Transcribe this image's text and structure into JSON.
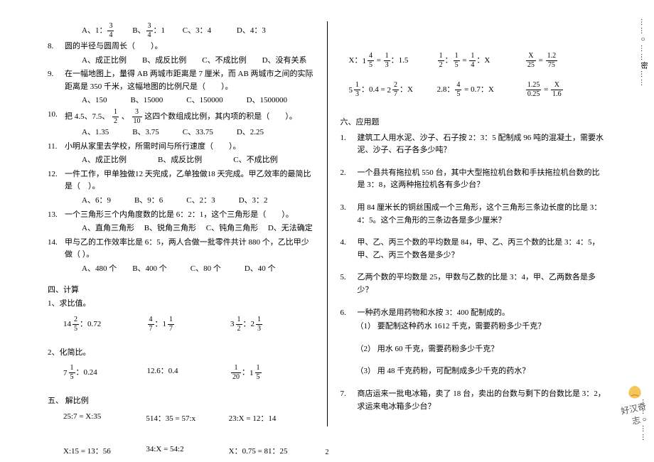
{
  "page_number": "2",
  "edge_top": "……○……密……",
  "edge_bottom_dots": "……○……",
  "edge_bottom_label": "好汉奇志",
  "left": {
    "q7_opts": [
      {
        "pre": "A、1：",
        "num": "3",
        "den": "4"
      },
      {
        "pre": "B、",
        "num": "3",
        "den": "4",
        "post": "：1"
      },
      {
        "pre": "C、3：4",
        "num": "",
        "den": ""
      },
      {
        "pre": "D、4：3",
        "num": "",
        "den": ""
      }
    ],
    "q8": {
      "n": "8.",
      "t": "圆的半径与圆周长（　　）。"
    },
    "q8_opts": "A、成正比例　　B、成反比例　　C、不成比例　　D、没有关系",
    "q9": {
      "n": "9.",
      "t": "在一幅地图上，量得 AB 两城市距离是 7 厘米，而 AB 两城市之间的实际距离是 350 千米，这幅地图的比例尺是（　　）。"
    },
    "q9_opts": "A、150　　　B、15000　　　C、150000　　　D、1500000",
    "q10": {
      "n": "10.",
      "t": ""
    },
    "q10_text_a": "把 4.5、7.5、",
    "q10_text_b": "、",
    "q10_text_c": " 这四个数组成比例，其内项的积是（　　）。",
    "q10_f1": {
      "num": "1",
      "den": "2"
    },
    "q10_f2": {
      "num": "3",
      "den": "10"
    },
    "q10_opts": "A、1.35　　　B、3.75　　　C、33.75　　　D、2.25",
    "q11": {
      "n": "11.",
      "t": "小明从家里去学校，所需时间与所行速度（　　）。"
    },
    "q11_opts": "A、成正比例　　　　B、成反比例　　　　C、不成比例",
    "q12": {
      "n": "12.",
      "t": "一件工作，甲单独做12 天完成，乙单独做18 天完成。甲乙效率的最简比是（　）。"
    },
    "q12_opts": "A、6：9　　　B、9：6　　　C、2：3　　　D、3：2",
    "q13": {
      "n": "13.",
      "t": "一个三角形三个内角度数的比是 6：2：1，这个三角形是（　　）。"
    },
    "q13_opts": "A、直角三角形　 B、锐角三角形　 C、钝角三角形　 D、无法确定",
    "q14": {
      "n": "14.",
      "t": "甲与乙的工作效率比是 6：5，两人合做一批零件共计 880 个，乙比甲少做（ ）。"
    },
    "q14_opts": "A、480 个　　B、400 个　　　C、80 个　　　D、40 个",
    "s4": "四、计算",
    "s4_1": "1、求比值。",
    "s4_1_eq": [
      {
        "left": {
          "w": "14",
          "n": "2",
          "d": "5"
        },
        "mid": "：0.72"
      },
      {
        "left": {
          "w": "",
          "n": "4",
          "d": "7"
        },
        "mid": "：",
        "right": {
          "w": "1",
          "n": "1",
          "d": "7"
        }
      },
      {
        "left": {
          "w": "3",
          "n": "1",
          "d": "2"
        },
        "mid": "：",
        "right": {
          "w": "2",
          "n": "1",
          "d": "3"
        }
      }
    ],
    "s4_2": "2、化简比。",
    "s4_2_eq": [
      {
        "left": {
          "w": "7",
          "n": "1",
          "d": "5"
        },
        "mid": "：0.24"
      },
      {
        "plain": "12.6：0.4"
      },
      {
        "left": {
          "w": "",
          "n": "1",
          "d": "20"
        },
        "mid": "：",
        "right": {
          "w": "1",
          "n": "1",
          "d": "5"
        }
      }
    ],
    "s5": "五、 解比例",
    "s5_row1": [
      "25:7 = X:35",
      "514：35 = 57:x",
      "23:X = 12：14"
    ],
    "s5_row2": [
      "X:15 = 13：56",
      "34:X = 54:2",
      "X：0.75 = 81：25"
    ]
  },
  "right": {
    "row1": [
      {
        "lhs": "X：",
        "m1": {
          "w": "1",
          "n": "4",
          "d": "5"
        },
        "eq": " = ",
        "m2": {
          "w": "",
          "n": "1",
          "d": "3"
        },
        "tail": "：1.5"
      },
      {
        "m1": {
          "w": "",
          "n": "1",
          "d": "2"
        },
        "colon": "：",
        "m2": {
          "w": "",
          "n": "1",
          "d": "5"
        },
        "eq": " = ",
        "m3": {
          "w": "",
          "n": "1",
          "d": "4"
        },
        "tail": "：X"
      },
      {
        "f1": {
          "n": "X",
          "d": "25"
        },
        "eq": " = ",
        "f2": {
          "n": "1.2",
          "d": "75"
        }
      }
    ],
    "row2": [
      {
        "m1": {
          "w": "5",
          "n": "1",
          "d": "3"
        },
        "colon": "：0.4 = ",
        "m2": {
          "w": "2",
          "n": "2",
          "d": "7"
        },
        "tail": "：X"
      },
      {
        "lhs": "2.8：",
        "m1": {
          "w": "",
          "n": "4",
          "d": "5"
        },
        "tail": " = 0.7：X"
      },
      {
        "f1": {
          "n": "1.25",
          "d": "0.25"
        },
        "eq": " = ",
        "f2": {
          "n": "X",
          "d": "1.6"
        }
      }
    ],
    "s6": "六、应用题",
    "q1": {
      "n": "1.",
      "t": "建筑工人用水泥、沙子、石子按 2：3：5 配制成 96 吨的混凝土，需要水泥、沙子、石子各多少吨？"
    },
    "q2": {
      "n": "2.",
      "t": "一个县共有拖拉机 550 台，其中大型拖拉机台数和手扶拖拉机台数的比是 3：8，这两种拖拉机各有多少台？"
    },
    "q3": {
      "n": "3.",
      "t": "用 84 厘米长的铜丝围成一个三角形，这个三角形三条边长度的比是 3：4：5。这个三角形的三条边各是多少厘米？"
    },
    "q4": {
      "n": "4.",
      "t": "甲、乙、丙三个数的平均数是 84，甲、乙、丙三个数的比是 3：4：5，甲、乙、丙三个数各是多少？"
    },
    "q5": {
      "n": "5.",
      "t": "乙两个数的平均数是 25，甲数与乙数的比是 3：4，甲、乙两数各是多少？"
    },
    "q6": {
      "n": "6.",
      "t": "一种药水是用药物和水按 3：400 配制成的。"
    },
    "q6_1": "（1）  要配制这种药水 1612 千克，需要药粉多少千克？",
    "q6_2": "（2）  用水 60 千克，需要药粉多少千克？",
    "q6_3": "（3）  用 48 千克药粉，可配制成多少千克的药水？",
    "q7": {
      "n": "7.",
      "t": "商店运来一批电冰箱，卖了 18 台，卖出的台数与剩下的台数比是 3：2，求运来电冰箱多少台？"
    }
  }
}
